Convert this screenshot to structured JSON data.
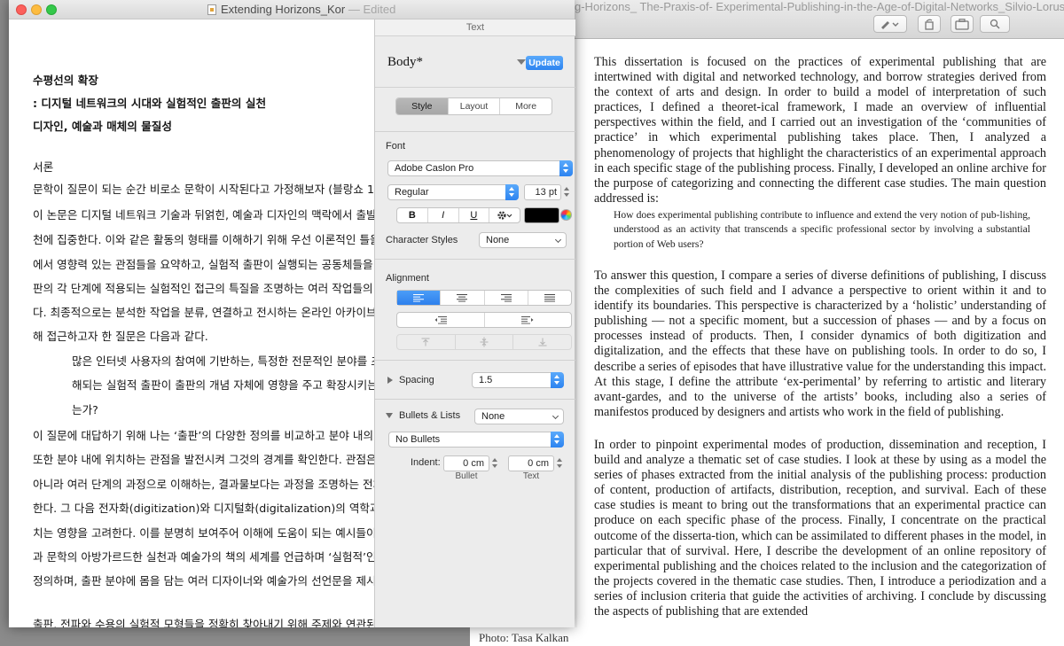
{
  "pdf_window": {
    "title": "g-Horizons_ The-Praxis-of- Experimental-Publishing-in-the-Age-of-Digital-Networks_Silvio-Lorusso.pdf (page",
    "photo_credit": "Photo: Tasa Kalkan",
    "paragraph_1": "This dissertation is focused on the practices of experimental publishing that are intertwined with digital and networked technology, and borrow strategies derived from the context of arts and design. In order to build a model of interpretation of such practices, I defined a theoret-ical framework, I made an overview of influential perspectives within the field, and I carried out an investigation of the ‘communities of practice’ in which experimental publishing takes place. Then, I analyzed a phenomenology of projects that highlight the characteristics of an experimental approach in each specific stage of the publishing process. Finally, I developed an online archive for the purpose of categorizing and connecting the different case studies. The main question addressed is:",
    "quote": "How does experimental publishing contribute to influence and extend the very notion of pub-lishing, understood as an activity that transcends a specific professional sector by involving a substantial portion of Web users?",
    "paragraph_2": "To answer this question, I compare a series of diverse definitions of publishing, I discuss the complexities of such field and I advance a perspective to orient within it and to identify its boundaries. This perspective is characterized by a ‘holistic’ understanding of publishing — not a specific moment, but a succession of phases — and by a focus on processes instead of products. Then, I consider dynamics of both digitization and digitalization, and the effects that these have on publishing tools. In order to do so, I describe a series of episodes that have illustrative value for the understanding this impact. At this stage, I define the attribute ‘ex-perimental’ by referring to artistic and literary avant-gardes, and to the universe of the artists’ books, including also a series of manifestos produced by designers and artists who work in the field of publishing.",
    "paragraph_3": "In order to pinpoint experimental modes of production, dissemination and reception, I build and analyze a thematic set of case studies. I look at these by using as a model the series of phases extracted from the initial analysis of the publishing process: production of content, production of artifacts, distribution, reception, and survival. Each of these case studies is meant to bring out the transformations that an experimental practice can produce on each specific phase of the process. Finally, I concentrate on the practical outcome of the disserta-tion, which can be assimilated to different phases in the model, in particular that of survival. Here, I describe the development of an online repository of experimental publishing and the choices related to the inclusion and the categorization of the projects covered in the thematic case studies. Then, I introduce a periodization and a series of inclusion criteria that guide the activities of archiving. I conclude by discussing the aspects of publishing that are extended"
  },
  "pages_window": {
    "title": "Extending Horizons_Kor",
    "edited": "— Edited",
    "document_lines": [
      "수평선의 확장",
      ": 디지털 네트워크의 시대와 실험적인 출판의 실천",
      "디자인, 예술과 매체의 물질성",
      "서론",
      "문학이 질문이 되는 순간 비로소 문학이 시작된다고 가정해보자 (블랑쇼 1959).",
      "이 논문은 디지털 네트워크 기술과 뒤얽힌, 예술과 디자인의 맥락에서 출발",
      "천에 집중한다. 이와 같은 활동의 형태를 이해하기 위해 우선 이론적인 틀을",
      "에서 영향력 있는 관점들을 요약하고, 실험적 출판이 실행되는 공동체들을",
      "판의 각 단계에 적용되는 실험적인 접근의 특질을 조명하는 여러 작업들의",
      "다. 최종적으로는 분석한 작업을 분류, 연결하고 전시하는 온라인 아카이브",
      "해 접근하고자 한 질문은 다음과 같다.",
      "많은 인터넷 사용자의 참여에 기반하는, 특정한 전문적인 분야를 초",
      "해되는 실험적 출판이 출판의 개념 자체에 영향을 주고 확장시키는",
      "는가?",
      "이 질문에 대답하기 위해 나는 ‘출판’의 다양한 정의를 비교하고 분야 내의 복",
      "또한 분야 내에 위치하는 관점을 발전시켜 그것의 경계를 확인한다. 관점은",
      "아니라 여러 단계의 과정으로 이해하는, 결과물보다는 과정을 조명하는 전체",
      "한다. 그 다음 전자화(digitization)와 디지털화(digitalization)의 역학과 이",
      "치는 영향을 고려한다. 이를 분명히 보여주어 이해에 도움이 되는 예시들이",
      "과 문학의 아방가르드한 실천과 예술가의 책의 세계를 언급하며 ‘실험적’인",
      "정의하며, 출판 분야에 몸을 담는 여러 디자이너와 예술가의 선언문을 제시",
      "출판, 전파와 수용의 실험적 모형들을 정확히 찾아내기 위해 주제와 연관된"
    ]
  },
  "inspector": {
    "header": "Text",
    "paragraph_style": "Body*",
    "update_label": "Update",
    "tabs": [
      "Style",
      "Layout",
      "More"
    ],
    "active_tab": "Style",
    "font_section_label": "Font",
    "font_family": "Adobe Caslon Pro",
    "font_typeface": "Regular",
    "font_size": "13 pt",
    "char_buttons": [
      "B",
      "I",
      "U"
    ],
    "text_color": "#000000",
    "character_styles_label": "Character Styles",
    "character_styles_value": "None",
    "alignment_label": "Alignment",
    "spacing_label": "Spacing",
    "spacing_value": "1.5",
    "bullets_label": "Bullets & Lists",
    "bullets_value": "None",
    "bullet_type": "No Bullets",
    "indent_label": "Indent:",
    "bullet_indent": "0 cm",
    "text_indent": "0 cm",
    "bullet_caption": "Bullet",
    "text_caption": "Text"
  },
  "colors": {
    "accent_blue": "#2d84f0",
    "close": "#fc605c",
    "minimize": "#fdbc40",
    "zoom": "#34c84a"
  }
}
